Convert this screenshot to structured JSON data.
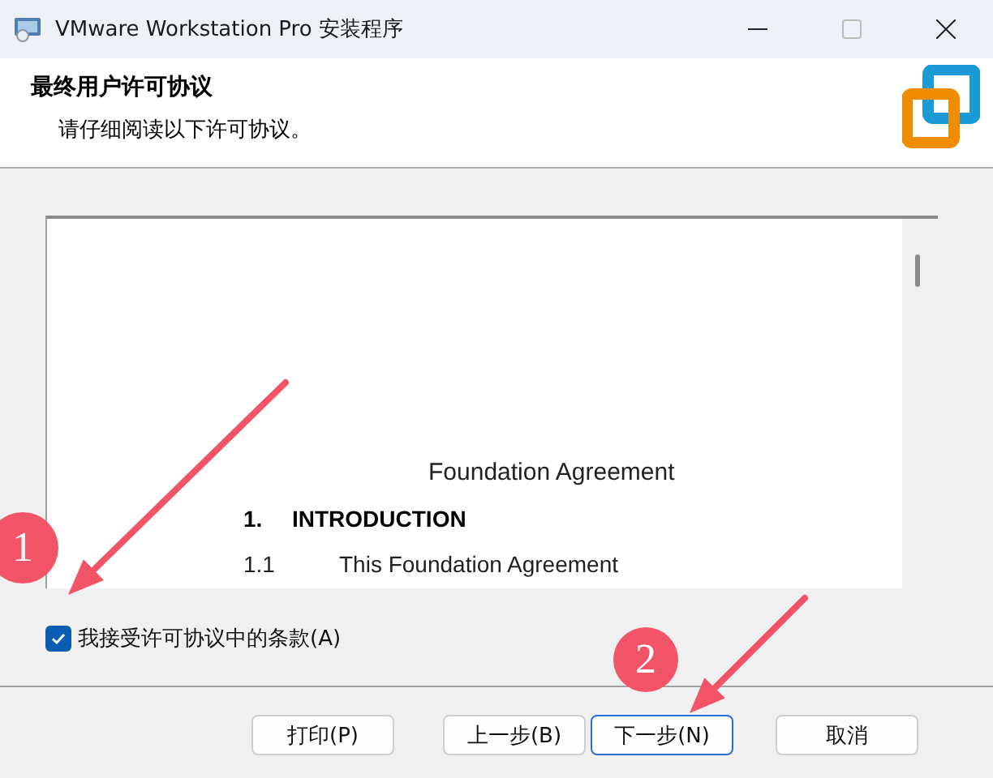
{
  "window": {
    "title": "VMware Workstation Pro 安装程序"
  },
  "header": {
    "title": "最终用户许可协议",
    "subtitle": "请仔细阅读以下许可协议。"
  },
  "document": {
    "lines": [
      {
        "kind": "heading",
        "text": "Foundation Agreement"
      },
      {
        "kind": "section",
        "number": "1.",
        "text": "INTRODUCTION"
      },
      {
        "kind": "clause",
        "number": "1.1",
        "text": "This Foundation Agreement"
      }
    ]
  },
  "accept_checkbox": {
    "label": "我接受许可协议中的条款(A)",
    "checked": true
  },
  "buttons": [
    {
      "label": "打印(P)",
      "default": false
    },
    {
      "label": "上一步(B)",
      "default": false
    },
    {
      "label": "下一步(N)",
      "default": true
    },
    {
      "label": "取消",
      "default": false
    }
  ],
  "annotations": [
    {
      "number": "1"
    },
    {
      "number": "2"
    }
  ]
}
